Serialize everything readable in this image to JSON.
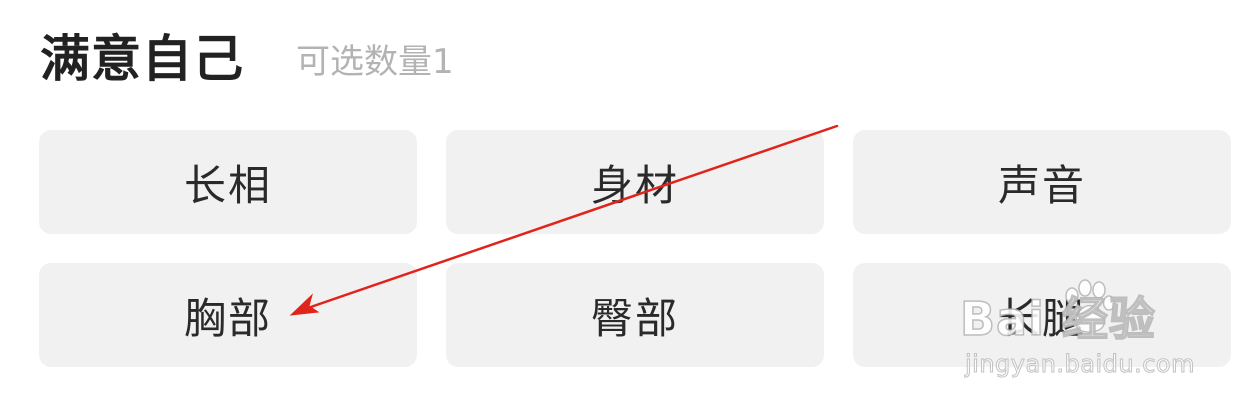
{
  "header": {
    "title": "满意自己",
    "subtitle": "可选数量1"
  },
  "options": [
    {
      "label": "长相"
    },
    {
      "label": "身材"
    },
    {
      "label": "声音"
    },
    {
      "label": "胸部"
    },
    {
      "label": "臀部"
    },
    {
      "label": "长腿"
    }
  ],
  "annotation": {
    "arrow_color": "#e0241c",
    "arrow_target": "胸部"
  },
  "watermark": {
    "logo_text": "Bai 经验",
    "url": "jingyan.baidu.com",
    "icon": "baidu-paw-icon"
  }
}
